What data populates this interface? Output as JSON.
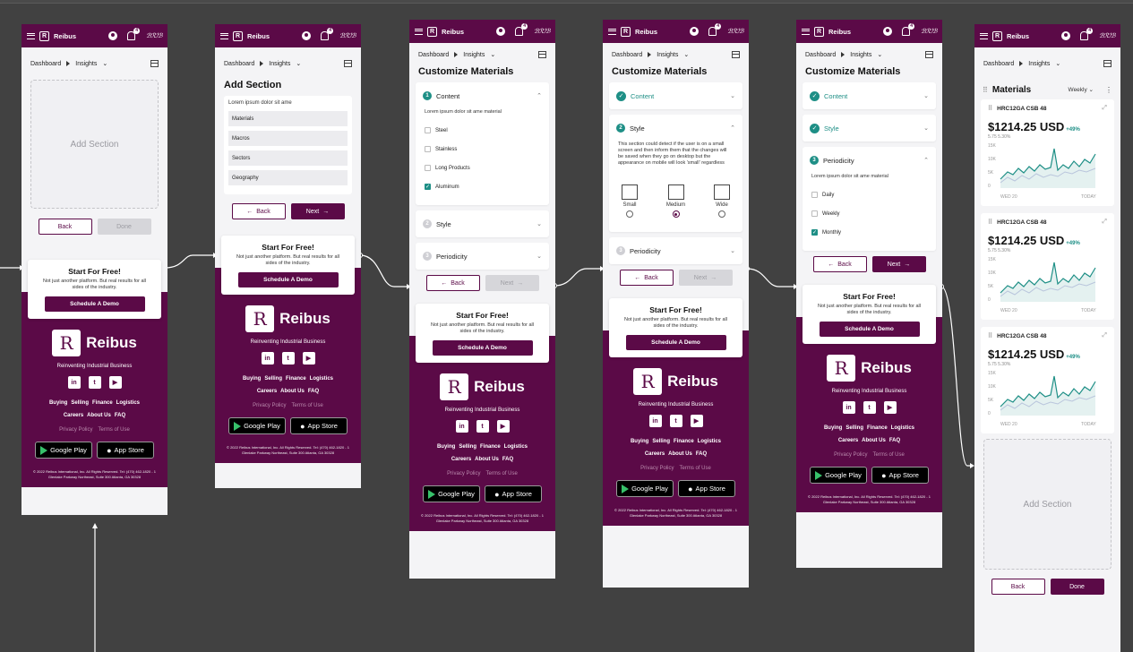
{
  "app": {
    "brand": "Reibus",
    "logo_letter": "R",
    "notif_count": "4",
    "sig": "ℬℛℐℬ"
  },
  "crumbs": {
    "home": "Dashboard",
    "section": "Insights",
    "chev": "⌄"
  },
  "screens": {
    "s1": {
      "add_section": "Add Section",
      "back": "Back",
      "done": "Done"
    },
    "s2": {
      "title": "Add Section",
      "desc": "Lorem ipsum dolor sit ame",
      "options": [
        "Materials",
        "Macros",
        "Sectors",
        "Geography"
      ],
      "back": "Back",
      "next": "Next"
    },
    "s3": {
      "title": "Customize Materials",
      "content": {
        "num": "1",
        "label": "Content",
        "desc": "Lorem ipsum dolor sit ame material",
        "items": [
          {
            "label": "Steel",
            "checked": false
          },
          {
            "label": "Stainless",
            "checked": false
          },
          {
            "label": "Long Products",
            "checked": false
          },
          {
            "label": "Aluminum",
            "checked": true
          }
        ]
      },
      "style": {
        "num": "2",
        "label": "Style"
      },
      "periodicity": {
        "num": "3",
        "label": "Periodicity"
      },
      "back": "Back",
      "next": "Next"
    },
    "s4": {
      "title": "Customize Materials",
      "content": {
        "label": "Content"
      },
      "style": {
        "num": "2",
        "label": "Style",
        "desc": "This section could detect if the user is on a small screen and then inform them that the changes will be saved when they go on desktop but the appearance on mobile will look 'small' regardless",
        "sizes": [
          {
            "label": "Small",
            "selected": false
          },
          {
            "label": "Medium",
            "selected": true
          },
          {
            "label": "Wide",
            "selected": false
          }
        ]
      },
      "periodicity": {
        "num": "3",
        "label": "Periodicity"
      },
      "back": "Back",
      "next": "Next"
    },
    "s5": {
      "title": "Customize Materials",
      "content": {
        "label": "Content"
      },
      "style": {
        "label": "Style"
      },
      "periodicity": {
        "num": "3",
        "label": "Periodicity",
        "desc": "Lorem ipsum dolor sit ame material",
        "items": [
          {
            "label": "Daily",
            "checked": false
          },
          {
            "label": "Weekly",
            "checked": false
          },
          {
            "label": "Monthly",
            "checked": true
          }
        ]
      },
      "back": "Back",
      "next": "Next"
    },
    "s6": {
      "title": "Materials",
      "period": "Weekly ⌄",
      "widgets": [
        {
          "name": "HRC12GA CSB 48",
          "price": "$1214.25 USD",
          "pct": "+49%",
          "sub": "5.75 5.30%"
        },
        {
          "name": "HRC12GA CSB 48",
          "price": "$1214.25 USD",
          "pct": "+49%",
          "sub": "5.75 5.30%"
        },
        {
          "name": "HRC12GA CSB 48",
          "price": "$1214.25 USD",
          "pct": "+49%",
          "sub": "5.75 5.30%"
        }
      ],
      "axis": {
        "y": [
          "15K",
          "10K",
          "5K",
          "0"
        ],
        "x_start": "WED 20",
        "x_end": "TODAY"
      },
      "add_section": "Add Section",
      "back": "Back",
      "done": "Done"
    }
  },
  "promo": {
    "title": "Start For Free!",
    "text": "Not just another platform. But real results for all sides of the industry.",
    "cta": "Schedule A Demo"
  },
  "footer": {
    "brand": "Reibus",
    "tagline": "Reinventing Industrial Business",
    "social": [
      "in",
      "t",
      "▶"
    ],
    "links1": [
      "Buying",
      "Selling",
      "Finance",
      "Logistics"
    ],
    "links2": [
      "Careers",
      "About Us",
      "FAQ"
    ],
    "legal": [
      "Privacy Policy",
      "Terms of Use"
    ],
    "google": "Google Play",
    "apple": "App Store",
    "copyright": "© 2022 Reibus International, Inc. All Rights Reserved. Tel: (470) 462-1820 - 1 Glenlake Parkway Northeast, Suite 300 Atlanta, GA 30328"
  },
  "colors": {
    "brand": "#5b0a47",
    "accent": "#1e8f86",
    "canvas": "#414141"
  }
}
